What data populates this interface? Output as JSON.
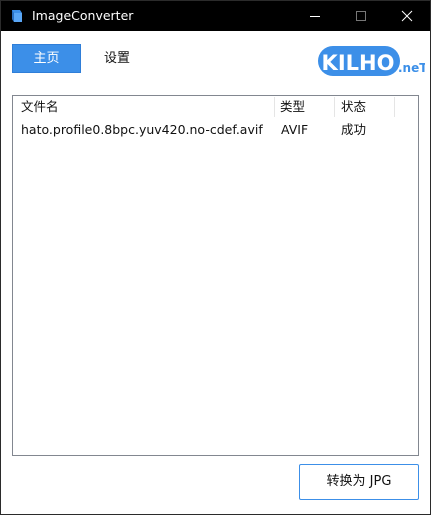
{
  "window": {
    "title": "ImageConverter",
    "controls": {
      "minimize": "minimize",
      "maximize": "maximize",
      "close": "close"
    }
  },
  "nav": {
    "tabs": [
      {
        "label": "主页",
        "active": true
      },
      {
        "label": "设置",
        "active": false
      }
    ]
  },
  "logo": {
    "text": "KILHO",
    "suffix": ".neT",
    "color": "#3c8fe8"
  },
  "file_list": {
    "columns": [
      "文件名",
      "类型",
      "状态"
    ],
    "rows": [
      {
        "name": "hato.profile0.8bpc.yuv420.no-cdef.avif",
        "type": "AVIF",
        "status": "成功"
      }
    ]
  },
  "actions": {
    "convert_label": "转换为 JPG"
  },
  "colors": {
    "accent": "#3c8fe8",
    "titlebar": "#000000"
  },
  "icons": [
    "app-icon",
    "minimize-icon",
    "maximize-icon",
    "close-icon"
  ]
}
